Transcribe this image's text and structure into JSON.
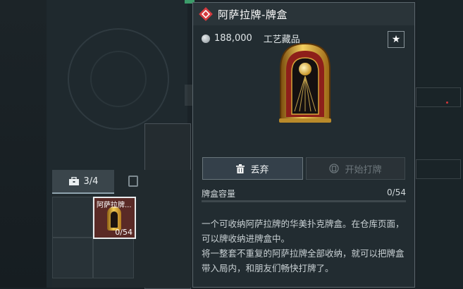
{
  "item": {
    "title": "阿萨拉牌-牌盒",
    "value": "188,000",
    "category": "工艺藏品",
    "star": "★",
    "rarity_color": "#d43a3f"
  },
  "actions": {
    "discard_label": "丢弃",
    "play_label": "开始打牌",
    "play_enabled": false
  },
  "capacity": {
    "label": "牌盒容量",
    "value": "0/54",
    "current": 0,
    "max": 54
  },
  "description": [
    "一个可收纳阿萨拉牌的华美扑克牌盒。在仓库页面，可以牌收纳进牌盒中。",
    "将一整套不重复的阿萨拉牌全部收纳，就可以把牌盒带入局内，和朋友们畅快打牌了。"
  ],
  "inventory": {
    "tab_count": "3/4",
    "slot": {
      "name": "阿萨拉牌...",
      "count": "0/54"
    }
  },
  "icons": {
    "rarity": "diamond-rarity-icon",
    "coin": "coin-icon",
    "star": "star-icon",
    "trash": "trash-icon",
    "cards": "cards-icon",
    "briefcase": "briefcase-icon"
  }
}
